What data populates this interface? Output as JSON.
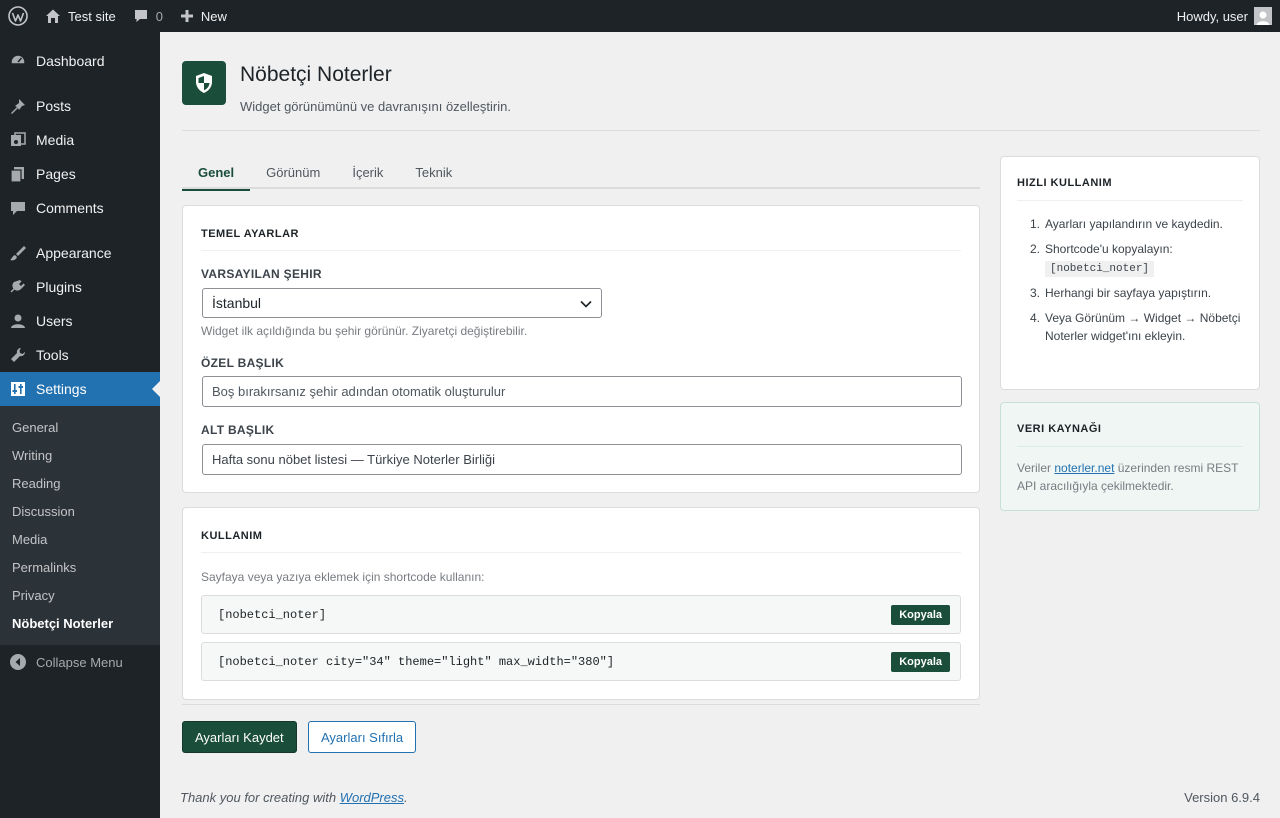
{
  "adminbar": {
    "site_name": "Test site",
    "comments_count": "0",
    "new_label": "New",
    "howdy": "Howdy, user"
  },
  "sidebar": {
    "items": [
      {
        "label": "Dashboard",
        "icon": "dashboard-icon"
      },
      {
        "label": "Posts",
        "icon": "pin-icon"
      },
      {
        "label": "Media",
        "icon": "media-icon"
      },
      {
        "label": "Pages",
        "icon": "pages-icon"
      },
      {
        "label": "Comments",
        "icon": "comment-icon"
      },
      {
        "label": "Appearance",
        "icon": "brush-icon"
      },
      {
        "label": "Plugins",
        "icon": "plugin-icon"
      },
      {
        "label": "Users",
        "icon": "user-icon"
      },
      {
        "label": "Tools",
        "icon": "wrench-icon"
      },
      {
        "label": "Settings",
        "icon": "settings-sliders-icon"
      }
    ],
    "submenu": [
      "General",
      "Writing",
      "Reading",
      "Discussion",
      "Media",
      "Permalinks",
      "Privacy",
      "Nöbetçi Noterler"
    ],
    "collapse_label": "Collapse Menu"
  },
  "header": {
    "title": "Nöbetçi Noterler",
    "subtitle": "Widget görünümünü ve davranışını özelleştirin."
  },
  "tabs": [
    "Genel",
    "Görünüm",
    "İçerik",
    "Teknik"
  ],
  "basic_settings": {
    "title": "TEMEL AYARLAR",
    "city_label": "VARSAYILAN ŞEHIR",
    "city_value": "İstanbul",
    "city_help": "Widget ilk açıldığında bu şehir görünür. Ziyaretçi değiştirebilir.",
    "custom_title_label": "ÖZEL BAŞLIK",
    "custom_title_placeholder": "Boş bırakırsanız şehir adından otomatik oluşturulur",
    "subtitle_label": "ALT BAŞLIK",
    "subtitle_value": "Hafta sonu nöbet listesi — Türkiye Noterler Birliği"
  },
  "usage": {
    "title": "KULLANIM",
    "help": "Sayfaya veya yazıya eklemek için shortcode kullanın:",
    "codes": [
      "[nobetci_noter]",
      "[nobetci_noter city=\"34\" theme=\"light\" max_width=\"380\"]"
    ],
    "copy_label": "Kopyala"
  },
  "buttons": {
    "save": "Ayarları Kaydet",
    "reset": "Ayarları Sıfırla"
  },
  "quick_use": {
    "title": "HIZLI KULLANIM",
    "steps": [
      {
        "num": "1.",
        "text": "Ayarları yapılandırın ve kaydedin."
      },
      {
        "num": "2.",
        "text": "Shortcode'u kopyalayın:",
        "code": "[nobetci_noter]"
      },
      {
        "num": "3.",
        "text": "Herhangi bir sayfaya yapıştırın."
      },
      {
        "num": "4.",
        "text": "Veya Görünüm → Widget → Nöbetçi Noterler widget'ını ekleyin."
      }
    ]
  },
  "data_source": {
    "title": "VERI KAYNAĞI",
    "text_before": "Veriler ",
    "link": "noterler.net",
    "text_after": " üzerinden resmi REST API aracılığıyla çekilmektedir."
  },
  "footer": {
    "thanks_before": "Thank you for creating with ",
    "thanks_link": "WordPress",
    "thanks_after": ".",
    "version": "Version 6.9.4"
  },
  "colors": {
    "brand": "#1a4d3a",
    "wp_blue": "#2271b1",
    "admin_dark": "#1d2327"
  }
}
